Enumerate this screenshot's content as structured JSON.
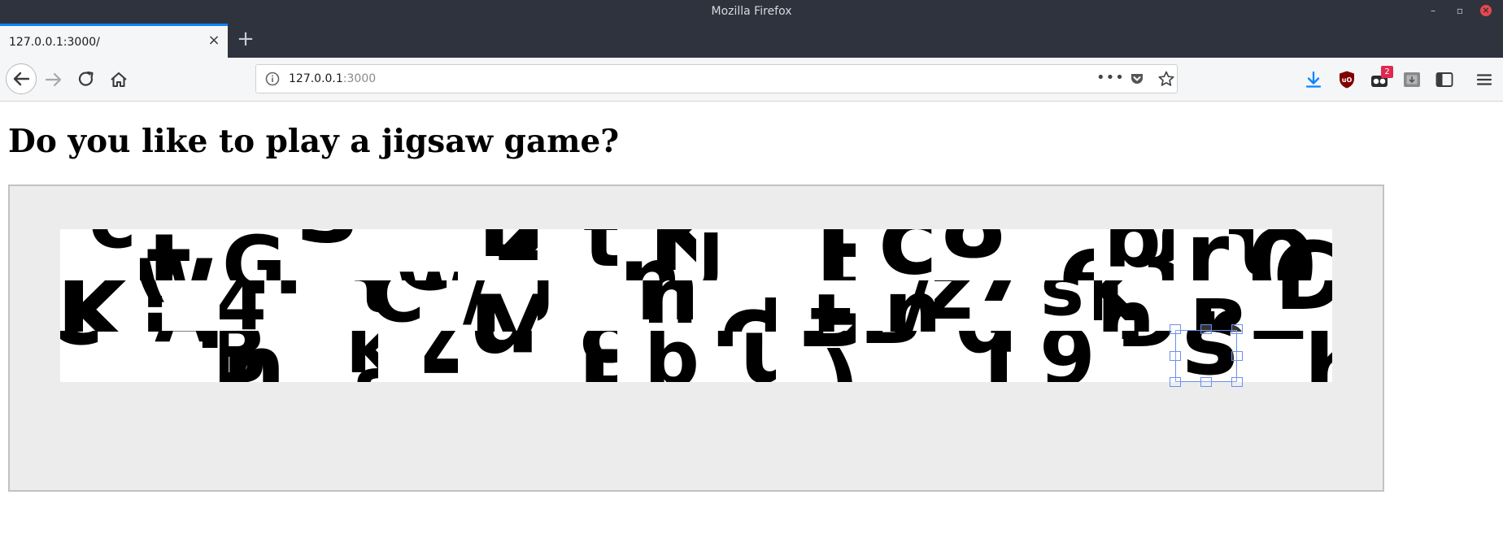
{
  "window": {
    "title": "Mozilla Firefox"
  },
  "tabs": [
    {
      "label": "127.0.0.1:3000/"
    }
  ],
  "urlbar": {
    "host": "127.0.0.1",
    "port": ":3000"
  },
  "toolbar": {
    "notification_badge": "2"
  },
  "page": {
    "heading": "Do you like to play a jigsaw game?"
  },
  "puzzle": {
    "rows": 3,
    "columns": 16
  },
  "colors": {
    "tab_accent": "#0a84ff",
    "board_bg": "#ececec",
    "selection": "#6c8ff0",
    "download_blue": "#0a84ff",
    "ublock_red": "#800000"
  }
}
